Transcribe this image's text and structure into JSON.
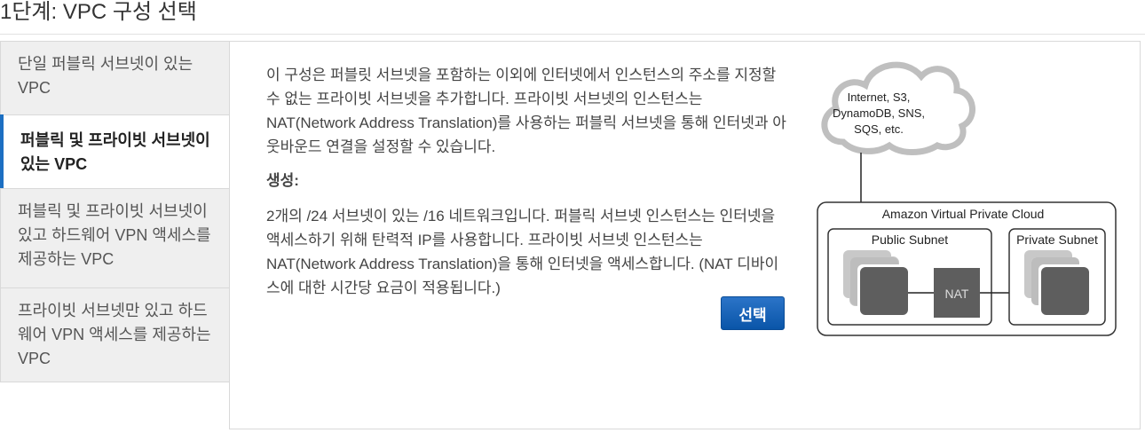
{
  "page": {
    "title": "1단계: VPC 구성 선택"
  },
  "sidebar": {
    "items": [
      {
        "label": "단일 퍼블릭 서브넷이 있는 VPC",
        "selected": false
      },
      {
        "label": "퍼블릭 및 프라이빗 서브넷이 있는 VPC",
        "selected": true
      },
      {
        "label": "퍼블릭 및 프라이빗 서브넷이 있고 하드웨어 VPN 액세스를 제공하는 VPC",
        "selected": false
      },
      {
        "label": "프라이빗 서브넷만 있고 하드웨어 VPN 액세스를 제공하는 VPC",
        "selected": false
      }
    ]
  },
  "main": {
    "description": "이 구성은 퍼블릿 서브넷을 포함하는 이외에 인터넷에서 인스턴스의 주소를 지정할 수 없는 프라이빗 서브넷을 추가합니다. 프라이빗 서브넷의 인스턴스는 NAT(Network Address Translation)를 사용하는 퍼블릭 서브넷을 통해 인터넷과 아웃바운드 연결을 설정할 수 있습니다.",
    "creates_heading": "생성:",
    "creates_body": "2개의 /24 서브넷이 있는 /16 네트워크입니다. 퍼블릭 서브넷 인스턴스는 인터넷을 액세스하기 위해 탄력적 IP를 사용합니다. 프라이빗 서브넷 인스턴스는 NAT(Network Address Translation)을 통해 인터넷을 액세스합니다. (NAT 디바이스에 대한 시간당 요금이 적용됩니다.)",
    "select_button": "선택"
  },
  "diagram": {
    "cloud_line1": "Internet, S3,",
    "cloud_line2": "DynamoDB, SNS,",
    "cloud_line3": "SQS, etc.",
    "vpc_label": "Amazon Virtual Private Cloud",
    "public_subnet_label": "Public Subnet",
    "private_subnet_label": "Private Subnet",
    "nat_label": "NAT"
  },
  "colors": {
    "accent": "#1c6fc2",
    "button": "#0a55a8"
  }
}
